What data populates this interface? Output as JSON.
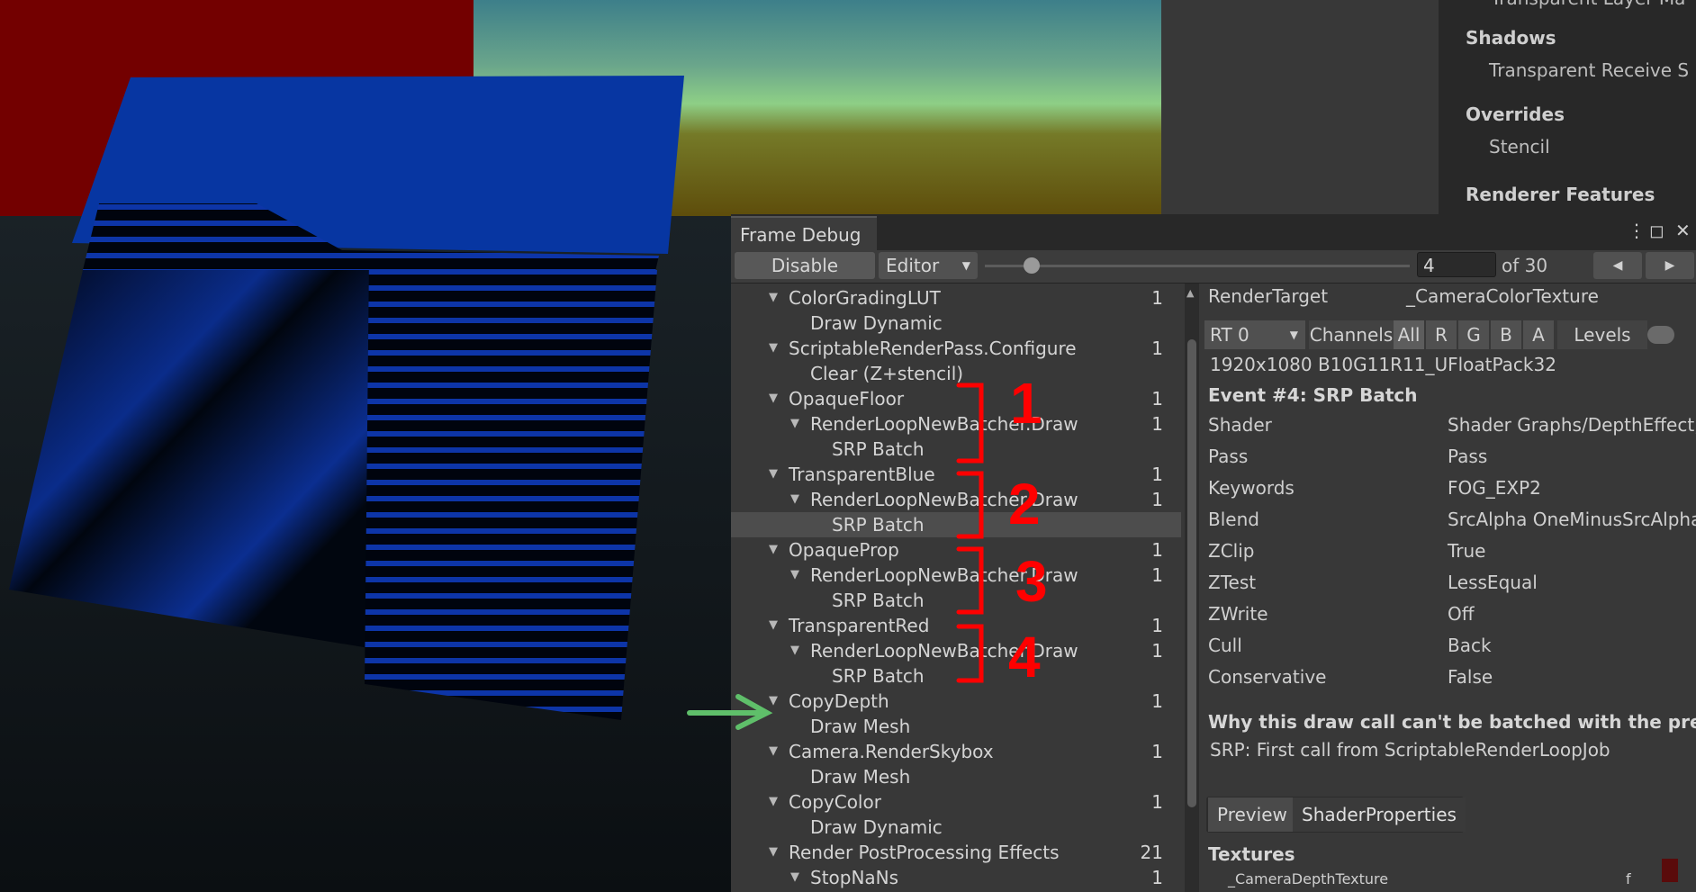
{
  "inspector": {
    "sections": [
      {
        "heading": "Shadows",
        "item": "Transparent Receive S"
      },
      {
        "heading": "Overrides",
        "item": "Stencil"
      },
      {
        "heading": "Renderer Features",
        "item": ""
      }
    ],
    "top_cut_text": "Transparent Layer Ma"
  },
  "frame_debug": {
    "title": "Frame Debug",
    "toolbar": {
      "disable_label": "Disable",
      "target": "Editor",
      "event_value": "4",
      "of_label": "of 30",
      "slider_fraction": 0.11
    },
    "tree": [
      {
        "label": "ColorGradingLUT",
        "count": "1",
        "depth": 0,
        "toggle": true
      },
      {
        "label": "Draw Dynamic",
        "count": "",
        "depth": 1,
        "toggle": false
      },
      {
        "label": "ScriptableRenderPass.Configure",
        "count": "1",
        "depth": 0,
        "toggle": true
      },
      {
        "label": "Clear (Z+stencil)",
        "count": "",
        "depth": 1,
        "toggle": false
      },
      {
        "label": "OpaqueFloor",
        "count": "1",
        "depth": 0,
        "toggle": true
      },
      {
        "label": "RenderLoopNewBatcher.Draw",
        "count": "1",
        "depth": 1,
        "toggle": true
      },
      {
        "label": "SRP Batch",
        "count": "",
        "depth": 2,
        "toggle": false
      },
      {
        "label": "TransparentBlue",
        "count": "1",
        "depth": 0,
        "toggle": true
      },
      {
        "label": "RenderLoopNewBatcher.Draw",
        "count": "1",
        "depth": 1,
        "toggle": true
      },
      {
        "label": "SRP Batch",
        "count": "",
        "depth": 2,
        "toggle": false,
        "selected": true
      },
      {
        "label": "OpaqueProp",
        "count": "1",
        "depth": 0,
        "toggle": true
      },
      {
        "label": "RenderLoopNewBatcher.Draw",
        "count": "1",
        "depth": 1,
        "toggle": true
      },
      {
        "label": "SRP Batch",
        "count": "",
        "depth": 2,
        "toggle": false
      },
      {
        "label": "TransparentRed",
        "count": "1",
        "depth": 0,
        "toggle": true
      },
      {
        "label": "RenderLoopNewBatcher.Draw",
        "count": "1",
        "depth": 1,
        "toggle": true
      },
      {
        "label": "SRP Batch",
        "count": "",
        "depth": 2,
        "toggle": false
      },
      {
        "label": "CopyDepth",
        "count": "1",
        "depth": 0,
        "toggle": true
      },
      {
        "label": "Draw Mesh",
        "count": "",
        "depth": 1,
        "toggle": false
      },
      {
        "label": "Camera.RenderSkybox",
        "count": "1",
        "depth": 0,
        "toggle": true
      },
      {
        "label": "Draw Mesh",
        "count": "",
        "depth": 1,
        "toggle": false
      },
      {
        "label": "CopyColor",
        "count": "1",
        "depth": 0,
        "toggle": true
      },
      {
        "label": "Draw Dynamic",
        "count": "",
        "depth": 1,
        "toggle": false
      },
      {
        "label": "Render PostProcessing Effects",
        "count": "21",
        "depth": 0,
        "toggle": true
      },
      {
        "label": "StopNaNs",
        "count": "1",
        "depth": 1,
        "toggle": true
      },
      {
        "label": "Draw Dynamic",
        "count": "",
        "depth": 2,
        "toggle": false
      }
    ],
    "details": {
      "render_target_label": "RenderTarget",
      "render_target_value": "_CameraColorTexture",
      "rt_select": "RT 0",
      "channels_label": "Channels",
      "channels": [
        "All",
        "R",
        "G",
        "B",
        "A"
      ],
      "levels_label": "Levels",
      "format": "1920x1080 B10G11R11_UFloatPack32",
      "event_title": "Event #4: SRP Batch",
      "properties": [
        {
          "label": "Shader",
          "value": "Shader Graphs/DepthEffect,"
        },
        {
          "label": "Pass",
          "value": "Pass"
        },
        {
          "label": "Keywords",
          "value": "FOG_EXP2"
        },
        {
          "label": "Blend",
          "value": "SrcAlpha OneMinusSrcAlpha"
        },
        {
          "label": "ZClip",
          "value": "True"
        },
        {
          "label": "ZTest",
          "value": "LessEqual"
        },
        {
          "label": "ZWrite",
          "value": "Off"
        },
        {
          "label": "Cull",
          "value": "Back"
        },
        {
          "label": "Conservative",
          "value": "False"
        }
      ],
      "batch_heading": "Why this draw call can't be batched with the previous",
      "batch_reason": "SRP: First call from ScriptableRenderLoopJob",
      "tabs": [
        "Preview",
        "ShaderProperties"
      ],
      "textures_heading": "Textures",
      "texture_name": "_CameraDepthTexture",
      "texture_stage": "f"
    }
  },
  "annotations": {
    "numbers": [
      "1",
      "2",
      "3",
      "4"
    ],
    "bracket_color": "#ff0000",
    "arrow_color": "#5fbf6a"
  }
}
